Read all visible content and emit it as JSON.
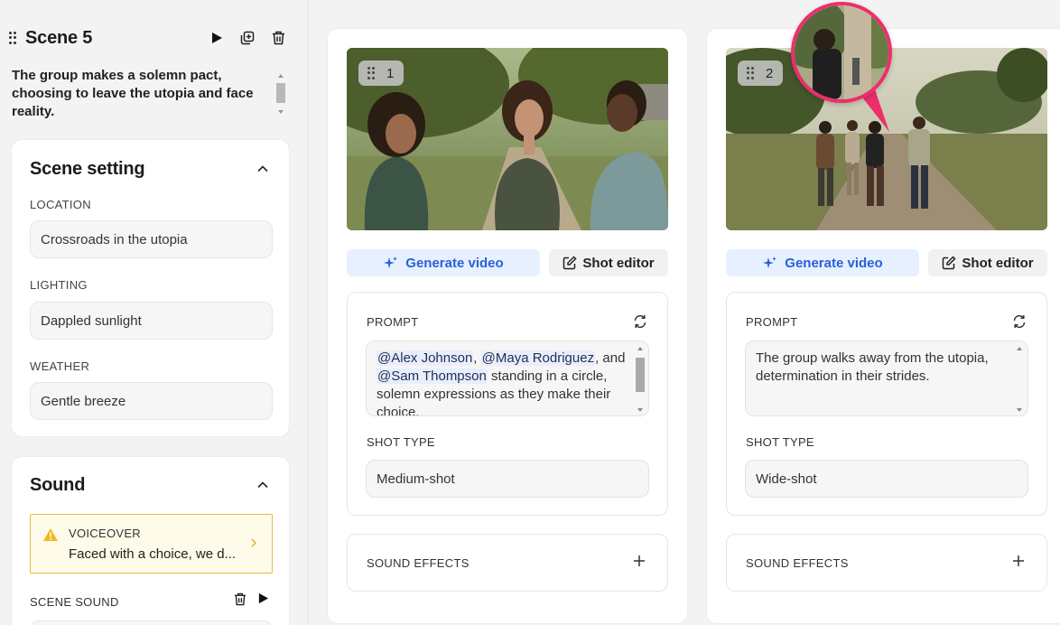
{
  "scene": {
    "title": "Scene 5",
    "description": "The group makes a solemn pact, choosing to leave the utopia and face reality."
  },
  "scene_setting": {
    "title": "Scene setting",
    "location_label": "LOCATION",
    "location_value": "Crossroads in the utopia",
    "lighting_label": "LIGHTING",
    "lighting_value": "Dappled sunlight",
    "weather_label": "WEATHER",
    "weather_value": "Gentle breeze"
  },
  "sound": {
    "title": "Sound",
    "voiceover_label": "VOICEOVER",
    "voiceover_text": "Faced with a choice, we d...",
    "scene_sound_label": "SCENE SOUND"
  },
  "shots": [
    {
      "number": "1",
      "generate_label": "Generate video",
      "editor_label": "Shot editor",
      "prompt_label": "PROMPT",
      "prompt_parts": {
        "m1": "@Alex Johnson",
        "sep1": ", ",
        "m2": "@Maya Rodriguez",
        "sep2": ", and ",
        "m3": "@Sam Thompson",
        "rest": " standing in a circle, solemn expressions as they make their choice."
      },
      "shot_type_label": "SHOT TYPE",
      "shot_type_value": "Medium-shot",
      "sfx_label": "SOUND EFFECTS"
    },
    {
      "number": "2",
      "generate_label": "Generate video",
      "editor_label": "Shot editor",
      "prompt_label": "PROMPT",
      "prompt_text": "The group walks away from the utopia, determination in their strides.",
      "shot_type_label": "SHOT TYPE",
      "shot_type_value": "Wide-shot",
      "sfx_label": "SOUND EFFECTS"
    }
  ],
  "colors": {
    "accent_blue": "#2b60d8",
    "voiceover_border": "#e2be45",
    "callout": "#ec2f6b"
  }
}
